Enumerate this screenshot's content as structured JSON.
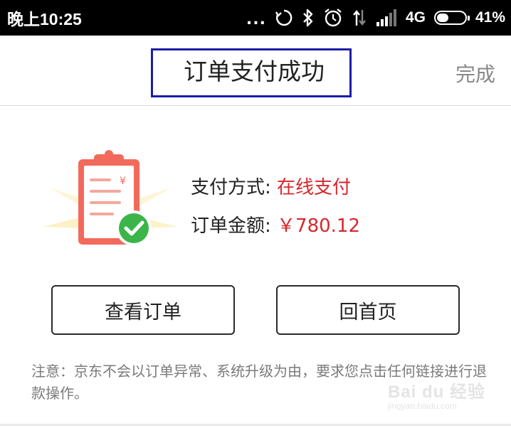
{
  "status_bar": {
    "time": "晚上10:25",
    "more_dots": "...",
    "network": "4G",
    "battery_percent": "41%",
    "battery_level": 0.41,
    "icons": [
      "sync-icon",
      "bluetooth-icon",
      "alarm-icon",
      "data-transfer-icon",
      "signal-icon",
      "battery-icon"
    ]
  },
  "header": {
    "title": "订单支付成功",
    "done_label": "完成"
  },
  "payment": {
    "method_label": "支付方式: ",
    "method_value": "在线支付",
    "amount_label": "订单金额: ",
    "amount_value": "￥780.12"
  },
  "buttons": {
    "view_order": "查看订单",
    "home": "回首页"
  },
  "notice": "注意：京东不会以订单异常、系统升级为由，要求您点击任何链接进行退款操作。",
  "watermark": {
    "main": "Bai du 经验",
    "sub": "jingyan.baidu.com"
  },
  "colors": {
    "accent_red": "#d8262c",
    "success_green": "#3bb54a",
    "clipboard_red": "#f26a5c",
    "title_box_border": "#1c1ca8"
  }
}
